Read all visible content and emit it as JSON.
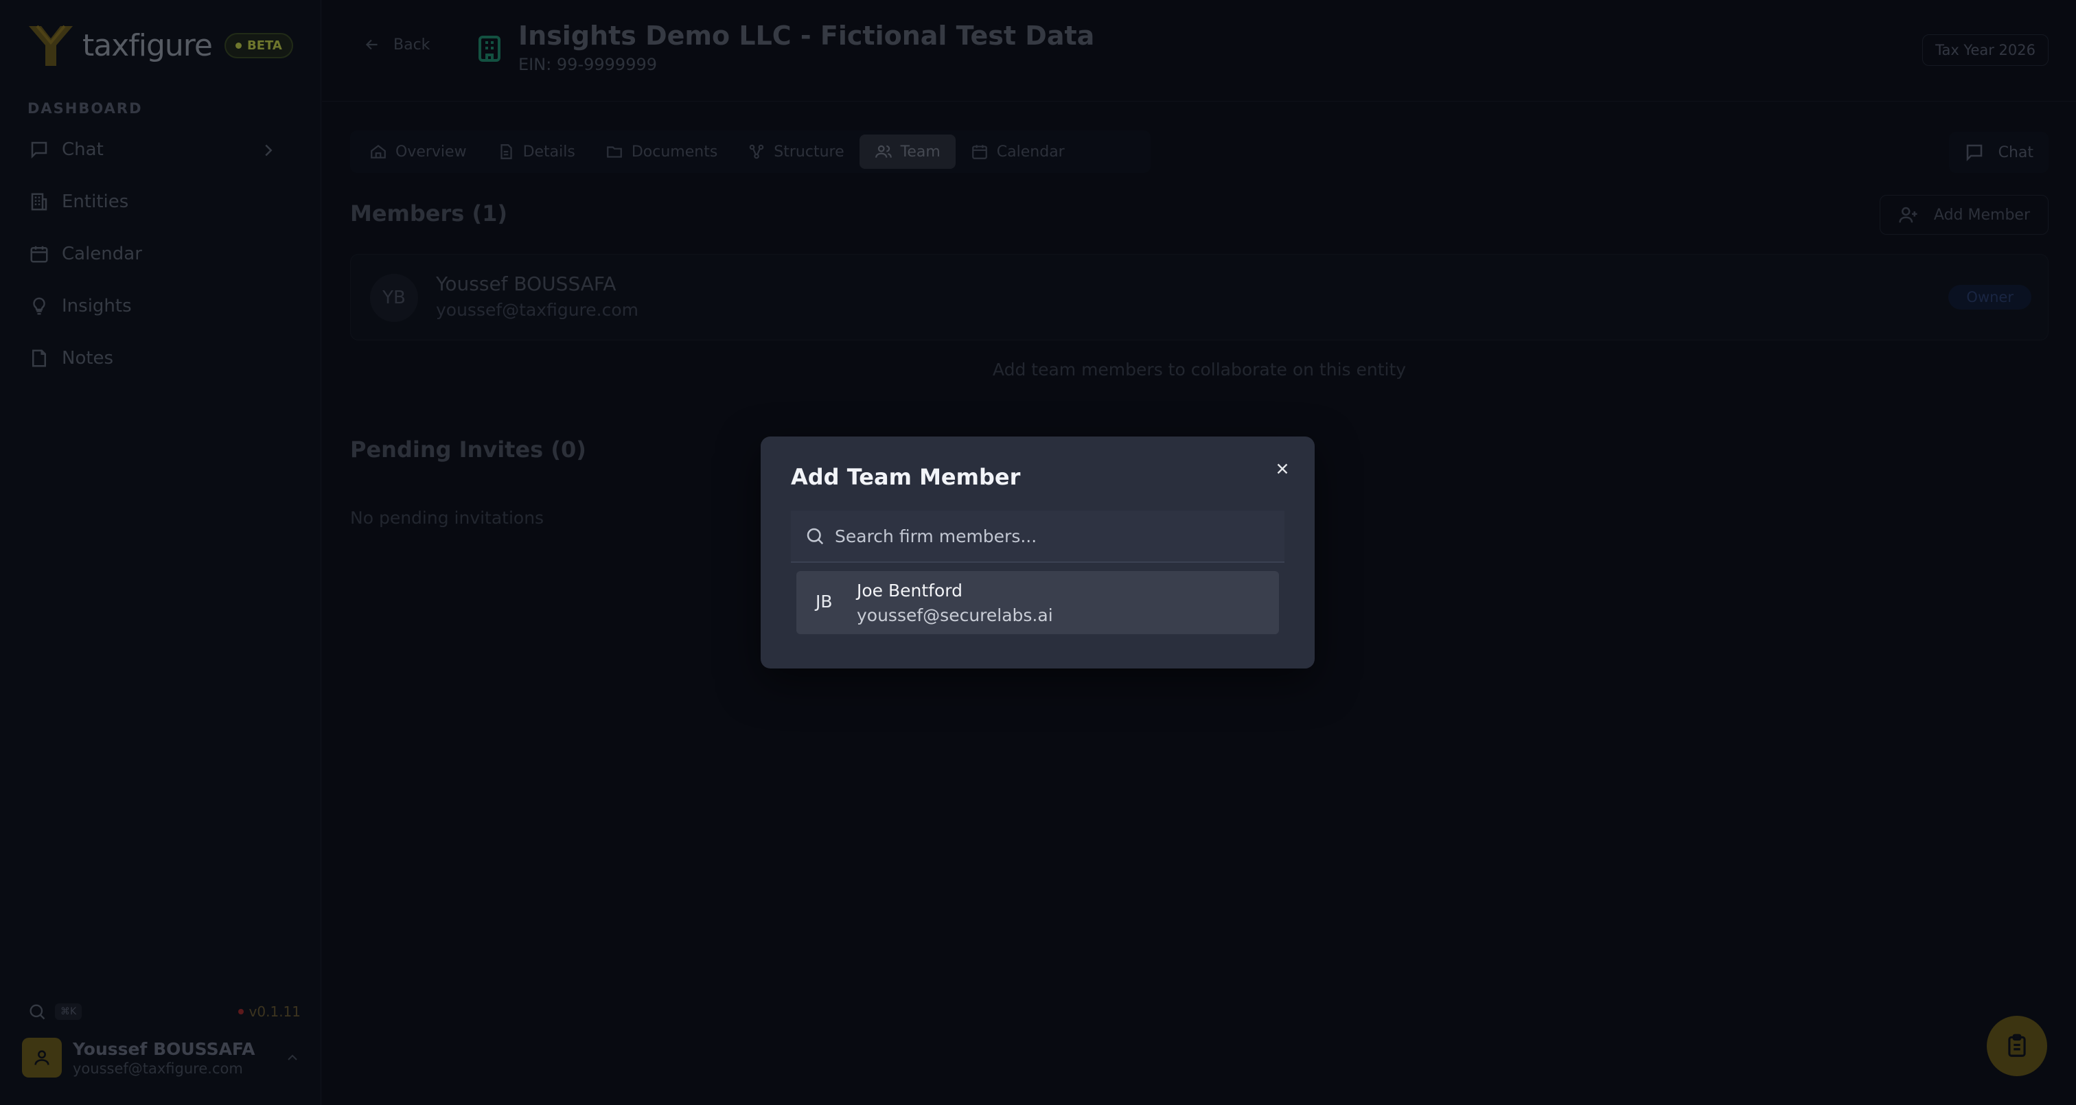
{
  "brand": {
    "name": "taxfigure",
    "badge": "BETA"
  },
  "sidebar": {
    "section_label": "DASHBOARD",
    "items": [
      {
        "label": "Chat",
        "icon": "message-square-icon"
      },
      {
        "label": "Entities",
        "icon": "building-icon"
      },
      {
        "label": "Calendar",
        "icon": "calendar-icon"
      },
      {
        "label": "Insights",
        "icon": "lightbulb-icon"
      },
      {
        "label": "Notes",
        "icon": "note-icon"
      }
    ],
    "shortcut": "⌘K",
    "version": "v0.1.11",
    "user": {
      "name": "Youssef BOUSSAFA",
      "email": "youssef@taxfigure.com"
    }
  },
  "header": {
    "back_label": "Back",
    "entity_name": "Insights Demo LLC - Fictional Test Data",
    "ein": "EIN: 99-9999999",
    "tax_year": "Tax Year 2026"
  },
  "tabs": [
    {
      "label": "Overview",
      "icon": "home-icon",
      "active": false
    },
    {
      "label": "Details",
      "icon": "file-text-icon",
      "active": false
    },
    {
      "label": "Documents",
      "icon": "folder-icon",
      "active": false
    },
    {
      "label": "Structure",
      "icon": "structure-icon",
      "active": false
    },
    {
      "label": "Team",
      "icon": "users-icon",
      "active": true
    },
    {
      "label": "Calendar",
      "icon": "calendar-icon",
      "active": false
    }
  ],
  "chat_button": "Chat",
  "members": {
    "title": "Members (1)",
    "add_label": "Add Member",
    "list": [
      {
        "initials": "YB",
        "name": "Youssef BOUSSAFA",
        "email": "youssef@taxfigure.com",
        "role": "Owner"
      }
    ],
    "hint": "Add team members to collaborate on this entity"
  },
  "pending": {
    "title": "Pending Invites (0)",
    "empty_text": "No pending invitations"
  },
  "modal": {
    "title": "Add Team Member",
    "search_placeholder": "Search firm members...",
    "results": [
      {
        "initials": "JB",
        "name": "Joe Bentford",
        "email": "youssef@securelabs.ai"
      }
    ]
  },
  "colors": {
    "background": "#0b0e16",
    "modal": "#2a2f3d",
    "accent_yellow": "#c7d34a",
    "entity_icon": "#1f8f6e"
  }
}
